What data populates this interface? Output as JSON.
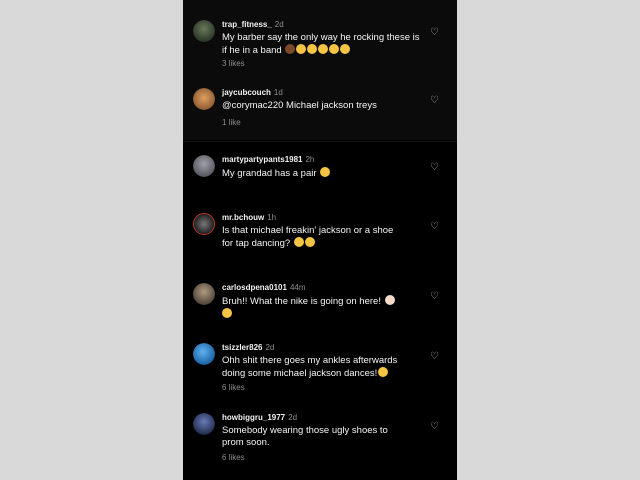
{
  "comments": [
    {
      "user": "trap_fitness_",
      "time": "2d",
      "text": "My barber say the only way he rocking these is if he in a band",
      "emoji_count": 6,
      "likes": "3 likes",
      "avatar_color": "#3d4a3a"
    },
    {
      "user": "jaycubcouch",
      "time": "1d",
      "text": "@corymac220 Michael jackson treys",
      "likes": "1 like",
      "avatar_color": "#c48a4a"
    },
    {
      "user": "martypartypants1981",
      "time": "2h",
      "text": "My grandad has a pair",
      "likes": "",
      "avatar_color": "#7c7c86"
    },
    {
      "user": "mr.bchouw",
      "time": "1h",
      "text": "Is that michael freakin' jackson or a shoe for tap dancing?",
      "likes": "",
      "avatar_color": "#2a2a2a"
    },
    {
      "user": "carlosdpena0101",
      "time": "44m",
      "text": "Bruh!! What the nike is going on here!",
      "likes": "",
      "avatar_color": "#8a7a66"
    },
    {
      "user": "tsizzler826",
      "time": "2d",
      "text": "Ohh shit there goes my ankles afterwards doing some michael jackson dances!",
      "likes": "6 likes",
      "avatar_color": "#1f6fb8"
    },
    {
      "user": "howbiggru_1977",
      "time": "2d",
      "text": "Somebody wearing those ugly shoes to prom soon.",
      "likes": "6 likes",
      "avatar_color": "#25324f"
    }
  ],
  "icons": {
    "heart": "♡"
  },
  "colors": {
    "background": "#000000",
    "username": "#f2f2f2",
    "meta": "#8e8e8e",
    "text": "#f5f5f5"
  }
}
